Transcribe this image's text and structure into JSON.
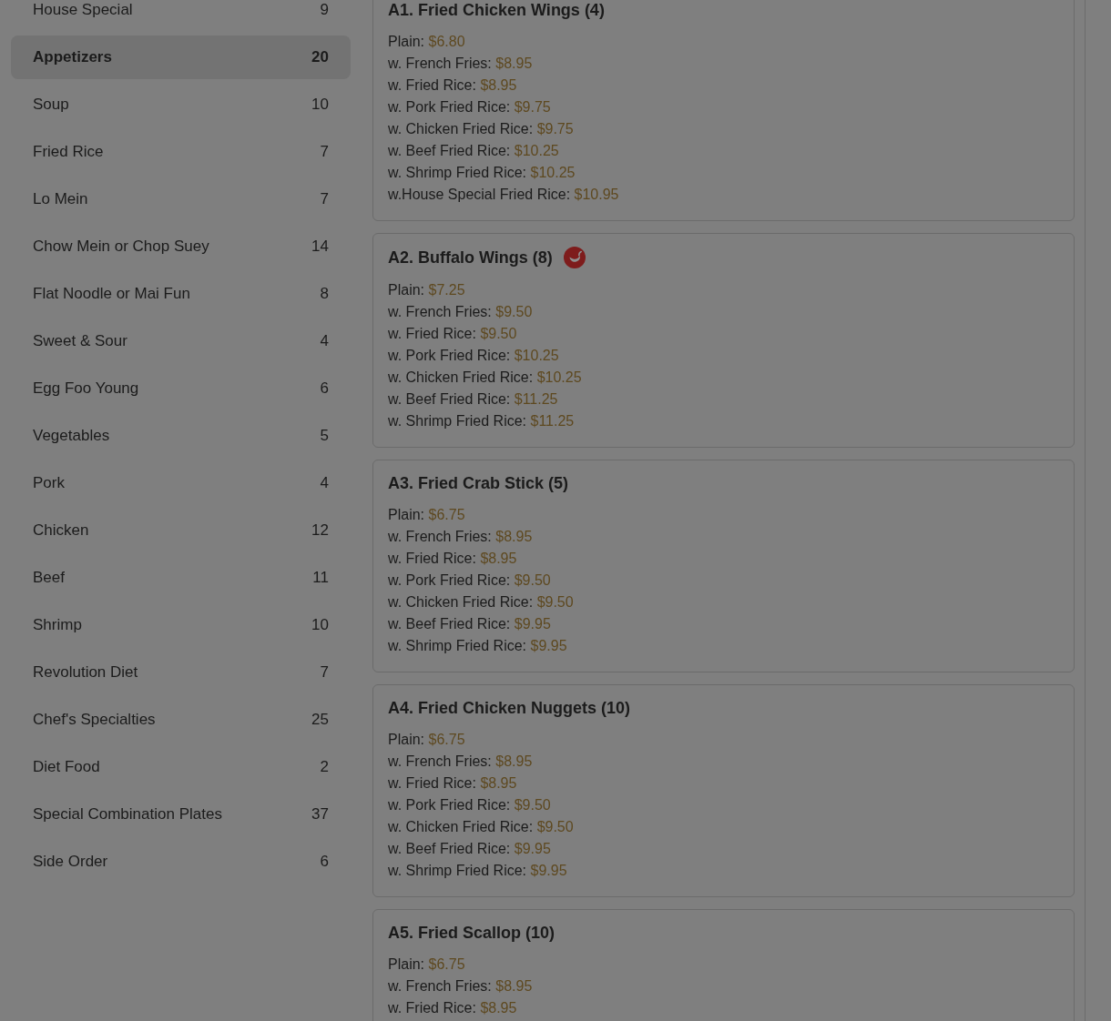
{
  "sidebar": {
    "categories": [
      {
        "name": "House Special",
        "count": "9",
        "selected": false
      },
      {
        "name": "Appetizers",
        "count": "20",
        "selected": true
      },
      {
        "name": "Soup",
        "count": "10",
        "selected": false
      },
      {
        "name": "Fried Rice",
        "count": "7",
        "selected": false
      },
      {
        "name": "Lo Mein",
        "count": "7",
        "selected": false
      },
      {
        "name": "Chow Mein or Chop Suey",
        "count": "14",
        "selected": false
      },
      {
        "name": "Flat Noodle or Mai Fun",
        "count": "8",
        "selected": false
      },
      {
        "name": "Sweet & Sour",
        "count": "4",
        "selected": false
      },
      {
        "name": "Egg Foo Young",
        "count": "6",
        "selected": false
      },
      {
        "name": "Vegetables",
        "count": "5",
        "selected": false
      },
      {
        "name": "Pork",
        "count": "4",
        "selected": false
      },
      {
        "name": "Chicken",
        "count": "12",
        "selected": false
      },
      {
        "name": "Beef",
        "count": "11",
        "selected": false
      },
      {
        "name": "Shrimp",
        "count": "10",
        "selected": false
      },
      {
        "name": "Revolution Diet",
        "count": "7",
        "selected": false
      },
      {
        "name": "Chef's Specialties",
        "count": "25",
        "selected": false
      },
      {
        "name": "Diet Food",
        "count": "2",
        "selected": false
      },
      {
        "name": "Special Combination Plates",
        "count": "37",
        "selected": false
      },
      {
        "name": "Side Order",
        "count": "6",
        "selected": false
      }
    ]
  },
  "menu_items": [
    {
      "title": "A1. Fried Chicken Wings (4)",
      "spicy": false,
      "prices": [
        {
          "label": "Plain:",
          "price": "$6.80"
        },
        {
          "label": "w. French Fries:",
          "price": "$8.95"
        },
        {
          "label": "w. Fried Rice:",
          "price": "$8.95"
        },
        {
          "label": "w. Pork Fried Rice:",
          "price": "$9.75"
        },
        {
          "label": "w. Chicken Fried Rice:",
          "price": "$9.75"
        },
        {
          "label": "w. Beef Fried Rice:",
          "price": "$10.25"
        },
        {
          "label": "w. Shrimp Fried Rice:",
          "price": "$10.25"
        },
        {
          "label": "w.House Special Fried Rice:",
          "price": "$10.95"
        }
      ]
    },
    {
      "title": "A2. Buffalo Wings (8)",
      "spicy": true,
      "prices": [
        {
          "label": "Plain:",
          "price": "$7.25"
        },
        {
          "label": "w. French Fries:",
          "price": "$9.50"
        },
        {
          "label": "w. Fried Rice:",
          "price": "$9.50"
        },
        {
          "label": "w. Pork Fried Rice:",
          "price": "$10.25"
        },
        {
          "label": "w. Chicken Fried Rice:",
          "price": "$10.25"
        },
        {
          "label": "w. Beef Fried Rice:",
          "price": "$11.25"
        },
        {
          "label": "w. Shrimp Fried Rice:",
          "price": "$11.25"
        }
      ]
    },
    {
      "title": "A3. Fried Crab Stick (5)",
      "spicy": false,
      "prices": [
        {
          "label": "Plain:",
          "price": "$6.75"
        },
        {
          "label": "w. French Fries:",
          "price": "$8.95"
        },
        {
          "label": "w. Fried Rice:",
          "price": "$8.95"
        },
        {
          "label": "w. Pork Fried Rice:",
          "price": "$9.50"
        },
        {
          "label": "w. Chicken Fried Rice:",
          "price": "$9.50"
        },
        {
          "label": "w. Beef Fried Rice:",
          "price": "$9.95"
        },
        {
          "label": "w. Shrimp Fried Rice:",
          "price": "$9.95"
        }
      ]
    },
    {
      "title": "A4. Fried Chicken Nuggets (10)",
      "spicy": false,
      "prices": [
        {
          "label": "Plain:",
          "price": "$6.75"
        },
        {
          "label": "w. French Fries:",
          "price": "$8.95"
        },
        {
          "label": "w. Fried Rice:",
          "price": "$8.95"
        },
        {
          "label": "w. Pork Fried Rice:",
          "price": "$9.50"
        },
        {
          "label": "w. Chicken Fried Rice:",
          "price": "$9.50"
        },
        {
          "label": "w. Beef Fried Rice:",
          "price": "$9.95"
        },
        {
          "label": "w. Shrimp Fried Rice:",
          "price": "$9.95"
        }
      ]
    },
    {
      "title": "A5. Fried Scallop (10)",
      "spicy": false,
      "prices": [
        {
          "label": "Plain:",
          "price": "$6.75"
        },
        {
          "label": "w. French Fries:",
          "price": "$8.95"
        },
        {
          "label": "w. Fried Rice:",
          "price": "$8.95"
        }
      ]
    }
  ]
}
